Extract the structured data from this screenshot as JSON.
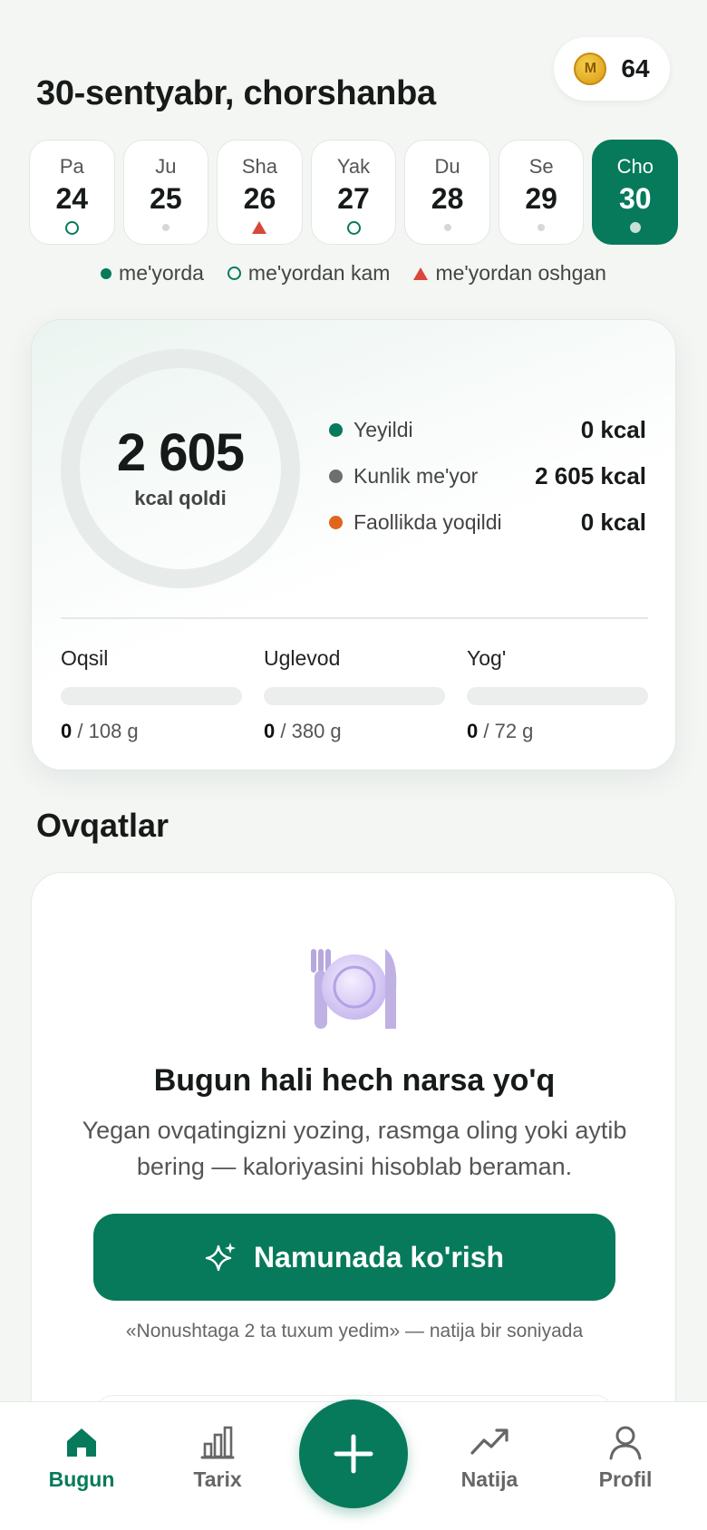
{
  "header": {
    "date_title": "30-sentyabr, chorshanba",
    "coins": "64",
    "coin_symbol": "M"
  },
  "week": [
    {
      "name": "Pa",
      "date": "24",
      "marker": "under"
    },
    {
      "name": "Ju",
      "date": "25",
      "marker": "none"
    },
    {
      "name": "Sha",
      "date": "26",
      "marker": "over"
    },
    {
      "name": "Yak",
      "date": "27",
      "marker": "under"
    },
    {
      "name": "Du",
      "date": "28",
      "marker": "none"
    },
    {
      "name": "Se",
      "date": "29",
      "marker": "none"
    },
    {
      "name": "Cho",
      "date": "30",
      "marker": "today",
      "active": true
    }
  ],
  "legend": {
    "normal": "me'yorda",
    "under": "me'yordan kam",
    "over": "me'yordan oshgan"
  },
  "summary": {
    "remaining_value": "2 605",
    "remaining_label": "kcal qoldi",
    "stats": [
      {
        "label": "Yeyildi",
        "value": "0 kcal",
        "color": "#067a5a"
      },
      {
        "label": "Kunlik me'yor",
        "value": "2 605 kcal",
        "color": "#6b6f6d"
      },
      {
        "label": "Faollikda yoqildi",
        "value": "0 kcal",
        "color": "#e2651e"
      }
    ],
    "macros": [
      {
        "label": "Oqsil",
        "eaten": "0",
        "target": "/ 108 g",
        "progress": 0
      },
      {
        "label": "Uglevod",
        "eaten": "0",
        "target": "/ 380 g",
        "progress": 0
      },
      {
        "label": "Yog'",
        "eaten": "0",
        "target": "/ 72 g",
        "progress": 0
      }
    ]
  },
  "meals": {
    "section_title": "Ovqatlar",
    "empty_title": "Bugun hali hech narsa yo'q",
    "empty_text": "Yegan ovqatingizni yozing, rasmga oling yoki aytib bering — kaloriyasini hisoblab beraman.",
    "cta_label": "Namunada ko'rish",
    "hint": "«Nonushtaga 2 ta tuxum yedim» — natija bir soniyada"
  },
  "tabbar": {
    "today": "Bugun",
    "history": "Tarix",
    "results": "Natija",
    "profile": "Profil"
  },
  "colors": {
    "accent": "#067a5a",
    "over": "#d9473a",
    "burned": "#e2651e"
  }
}
